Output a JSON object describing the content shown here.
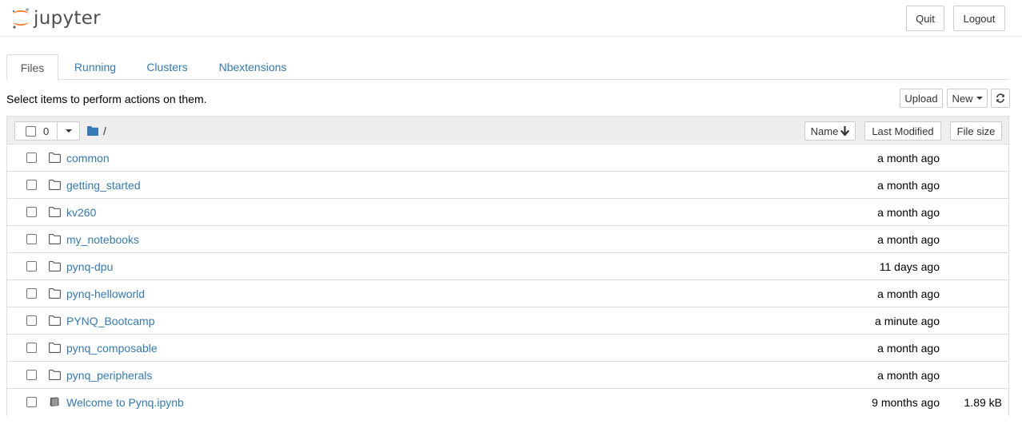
{
  "header": {
    "logo_text": "jupyter",
    "quit_label": "Quit",
    "logout_label": "Logout"
  },
  "tabs": [
    {
      "label": "Files",
      "active": true
    },
    {
      "label": "Running",
      "active": false
    },
    {
      "label": "Clusters",
      "active": false
    },
    {
      "label": "Nbextensions",
      "active": false
    }
  ],
  "toolbar": {
    "instructions": "Select items to perform actions on them.",
    "upload_label": "Upload",
    "new_label": "New",
    "refresh_icon": "refresh-icon"
  },
  "list_header": {
    "selected_count": "0",
    "breadcrumb": "/",
    "sort_name_label": "Name",
    "last_modified_label": "Last Modified",
    "file_size_label": "File size"
  },
  "files": [
    {
      "name": "common",
      "type": "folder",
      "modified": "a month ago",
      "size": ""
    },
    {
      "name": "getting_started",
      "type": "folder",
      "modified": "a month ago",
      "size": ""
    },
    {
      "name": "kv260",
      "type": "folder",
      "modified": "a month ago",
      "size": ""
    },
    {
      "name": "my_notebooks",
      "type": "folder",
      "modified": "a month ago",
      "size": ""
    },
    {
      "name": "pynq-dpu",
      "type": "folder",
      "modified": "11 days ago",
      "size": ""
    },
    {
      "name": "pynq-helloworld",
      "type": "folder",
      "modified": "a month ago",
      "size": ""
    },
    {
      "name": "PYNQ_Bootcamp",
      "type": "folder",
      "modified": "a minute ago",
      "size": ""
    },
    {
      "name": "pynq_composable",
      "type": "folder",
      "modified": "a month ago",
      "size": ""
    },
    {
      "name": "pynq_peripherals",
      "type": "folder",
      "modified": "a month ago",
      "size": ""
    },
    {
      "name": "Welcome to Pynq.ipynb",
      "type": "notebook",
      "modified": "9 months ago",
      "size": "1.89 kB"
    }
  ],
  "colors": {
    "link": "#337ab7",
    "logo_orange": "#f37726",
    "border": "#dddddd",
    "header_bg": "#eeeeee"
  }
}
